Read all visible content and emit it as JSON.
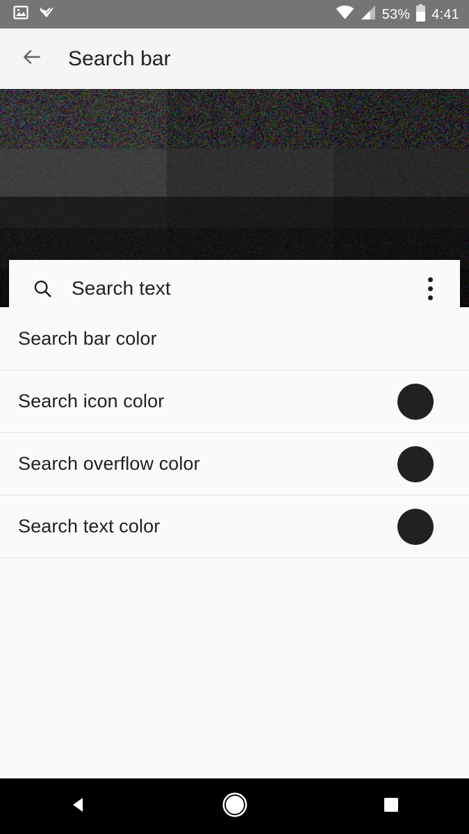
{
  "status_bar": {
    "left_icons": [
      {
        "name": "image-icon"
      },
      {
        "name": "tasks-check-icon"
      }
    ],
    "wifi_icon": "wifi-icon",
    "signal_icon": "cell-signal-icon",
    "battery_percent": "53%",
    "battery_icon": "battery-icon",
    "clock": "4:41",
    "background_color": "#757575",
    "foreground_color": "#ffffff"
  },
  "app_bar": {
    "back_icon": "arrow-back-icon",
    "title": "Search bar",
    "background_color": "#f5f5f5",
    "title_color": "#212121"
  },
  "preview": {
    "search_widget": {
      "search_icon": "search-icon",
      "placeholder": "Search text",
      "overflow_icon": "overflow-menu-icon",
      "background_color": "#fafafa",
      "text_color": "#212121",
      "icon_color": "#1c1c1c"
    }
  },
  "settings": {
    "rows": [
      {
        "label": "Search bar color",
        "swatch_color": "#ffffff",
        "has_swatch": false
      },
      {
        "label": "Search icon color",
        "swatch_color": "#212121",
        "has_swatch": true
      },
      {
        "label": "Search overflow color",
        "swatch_color": "#212121",
        "has_swatch": true
      },
      {
        "label": "Search text color",
        "swatch_color": "#212121",
        "has_swatch": true
      }
    ]
  },
  "nav_bar": {
    "back": "nav-back-icon",
    "home": "nav-home-icon",
    "recents": "nav-recents-icon",
    "background_color": "#000000"
  }
}
